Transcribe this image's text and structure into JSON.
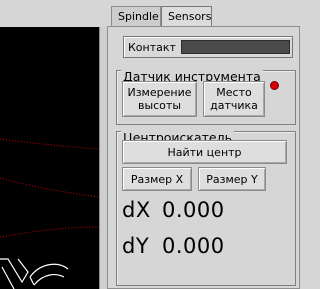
{
  "tabs": [
    {
      "label": "Spindle",
      "active": false
    },
    {
      "label": "Sensors",
      "active": true
    }
  ],
  "contact": {
    "label": "Контакт"
  },
  "tool_sensor": {
    "title": "Датчик инструмента",
    "measure_height": "Измерение\nвысоты",
    "sensor_location": "Место\nдатчика",
    "indicator_color": "#d80000"
  },
  "center_finder": {
    "title": "Центроискатель",
    "find_center": "Найти центр",
    "size_x": "Размер X",
    "size_y": "Размер Y",
    "dx_label": "dX",
    "dx_value": "0.000",
    "dy_label": "dY",
    "dy_value": "0.000"
  }
}
